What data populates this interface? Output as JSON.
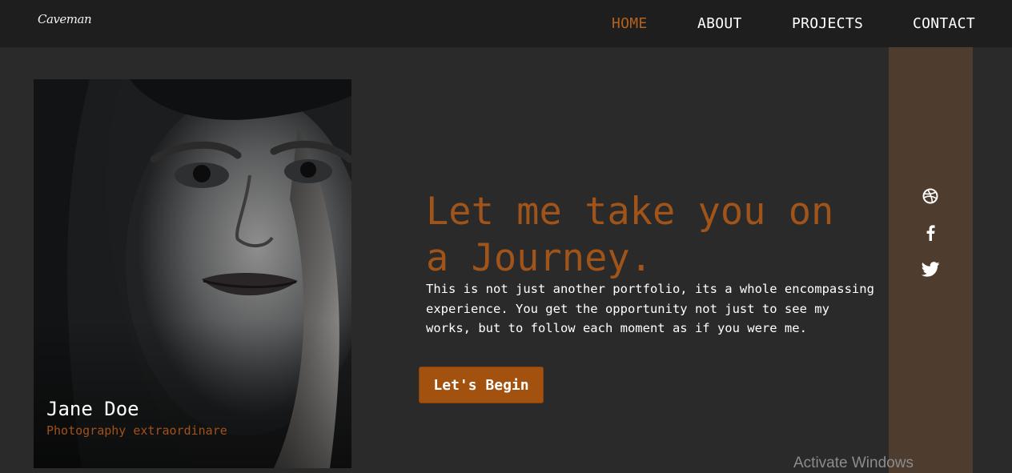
{
  "brand": {
    "logo_text": "Caveman"
  },
  "nav": {
    "items": [
      {
        "label": "HOME",
        "active": true
      },
      {
        "label": "ABOUT",
        "active": false
      },
      {
        "label": "PROJECTS",
        "active": false
      },
      {
        "label": "CONTACT",
        "active": false
      }
    ]
  },
  "profile": {
    "name": "Jane Doe",
    "tagline": "Photography extraordinare"
  },
  "hero": {
    "headline": "Let me take you on a Journey.",
    "intro": "This is not just another portfolio, its a whole encompassing experience. You get the opportunity not just to see my works, but to follow each moment as if you were me.",
    "cta_label": "Let's Begin"
  },
  "social": {
    "icons": [
      "dribbble-icon",
      "facebook-icon",
      "twitter-icon"
    ]
  },
  "system": {
    "watermark": "Activate Windows"
  },
  "colors": {
    "accent": "#a0541a",
    "nav_background": "#1e1e1e",
    "page_background": "#2a2a2a",
    "social_bar": "#4e3c2e",
    "button": "#a3510f"
  }
}
